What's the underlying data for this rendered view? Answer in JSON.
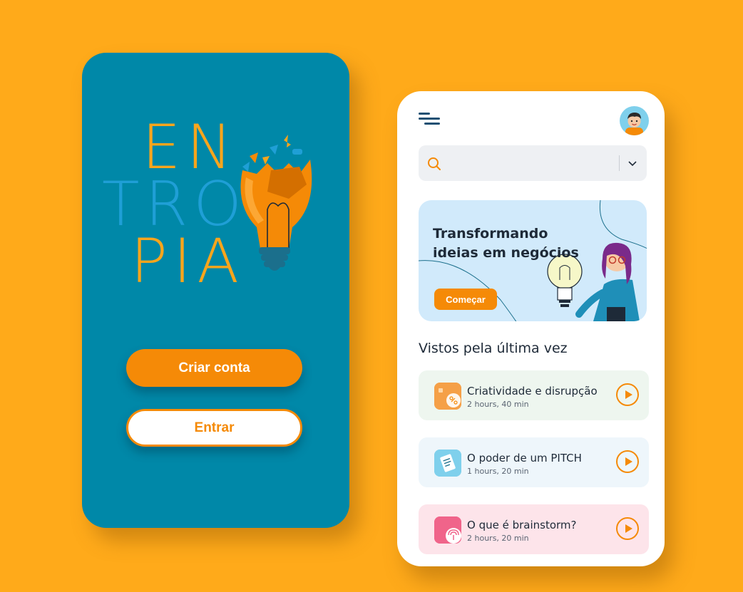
{
  "splash": {
    "logo_lines": [
      "EN",
      "TRO",
      "PIA"
    ],
    "primary_button": "Criar conta",
    "secondary_button": "Entrar"
  },
  "home": {
    "menu_icon": "menu-icon",
    "avatar_icon": "avatar-boy-icon",
    "search": {
      "placeholder": "",
      "value": ""
    },
    "banner": {
      "title": "Transformando ideias em negócios",
      "button": "Começar"
    },
    "recent_title": "Vistos pela última vez",
    "courses": [
      {
        "title": "Criatividade e disrupção",
        "duration": "2 hours, 40 min",
        "bg": "#EEF6EF",
        "thumb": "#F5A047"
      },
      {
        "title": "O poder de um PITCH",
        "duration": "1 hours, 20 min",
        "bg": "#EEF6FB",
        "thumb": "#7FD0EC"
      },
      {
        "title": "O que é brainstorm?",
        "duration": "2 hours, 20 min",
        "bg": "#FDE4EA",
        "thumb": "#F0648A"
      }
    ]
  },
  "colors": {
    "background": "#FFAA1A",
    "splash_bg": "#0088A8",
    "accent": "#F58A07",
    "banner_bg": "#D1EAFB"
  }
}
